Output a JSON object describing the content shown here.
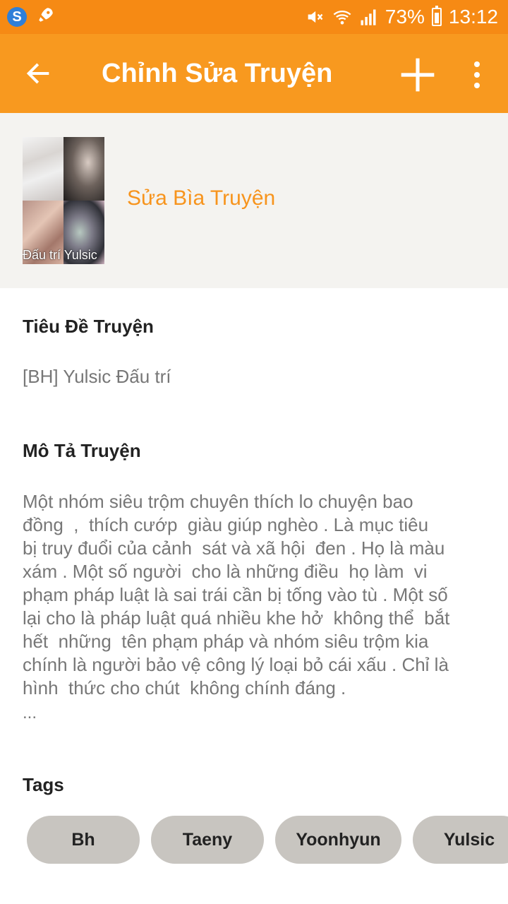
{
  "status_bar": {
    "battery": "73%",
    "time": "13:12"
  },
  "app_bar": {
    "title": "Chỉnh Sửa Truyện"
  },
  "cover": {
    "caption": "Đấu trí Yulsic",
    "edit_label": "Sửa Bìa Truyện"
  },
  "story_title": {
    "label": "Tiêu Đề Truyện",
    "value": "[BH] Yulsic Đấu trí"
  },
  "description": {
    "label": "Mô Tả Truyện",
    "value": "Một nhóm siêu trộm chuyên thích lo chuyện bao\nđồng  ,  thích cướp  giàu giúp nghèo . Là mục tiêu\nbị truy đuổi của cảnh  sát và xã hội  đen . Họ là màu\nxám . Một số người  cho là những điều  họ làm  vi\nphạm pháp luật là sai trái cần bị tống vào tù . Một số\nlại cho là pháp luật quá nhiều khe hở  không thể  bắt\nhết  những  tên phạm pháp và nhóm siêu trộm kia\nchính là người bảo vệ công lý loại bỏ cái xấu . Chỉ là\nhình  thức cho chút  không chính đáng .",
    "ellipsis": "..."
  },
  "tags": {
    "label": "Tags",
    "items": [
      "Bh",
      "Taeny",
      "Yoonhyun",
      "Yulsic"
    ]
  },
  "colors": {
    "app_bar": "#f8991f",
    "status_bar": "#f68a14",
    "accent": "#f7941d",
    "tag_bg": "#c8c5c0"
  }
}
